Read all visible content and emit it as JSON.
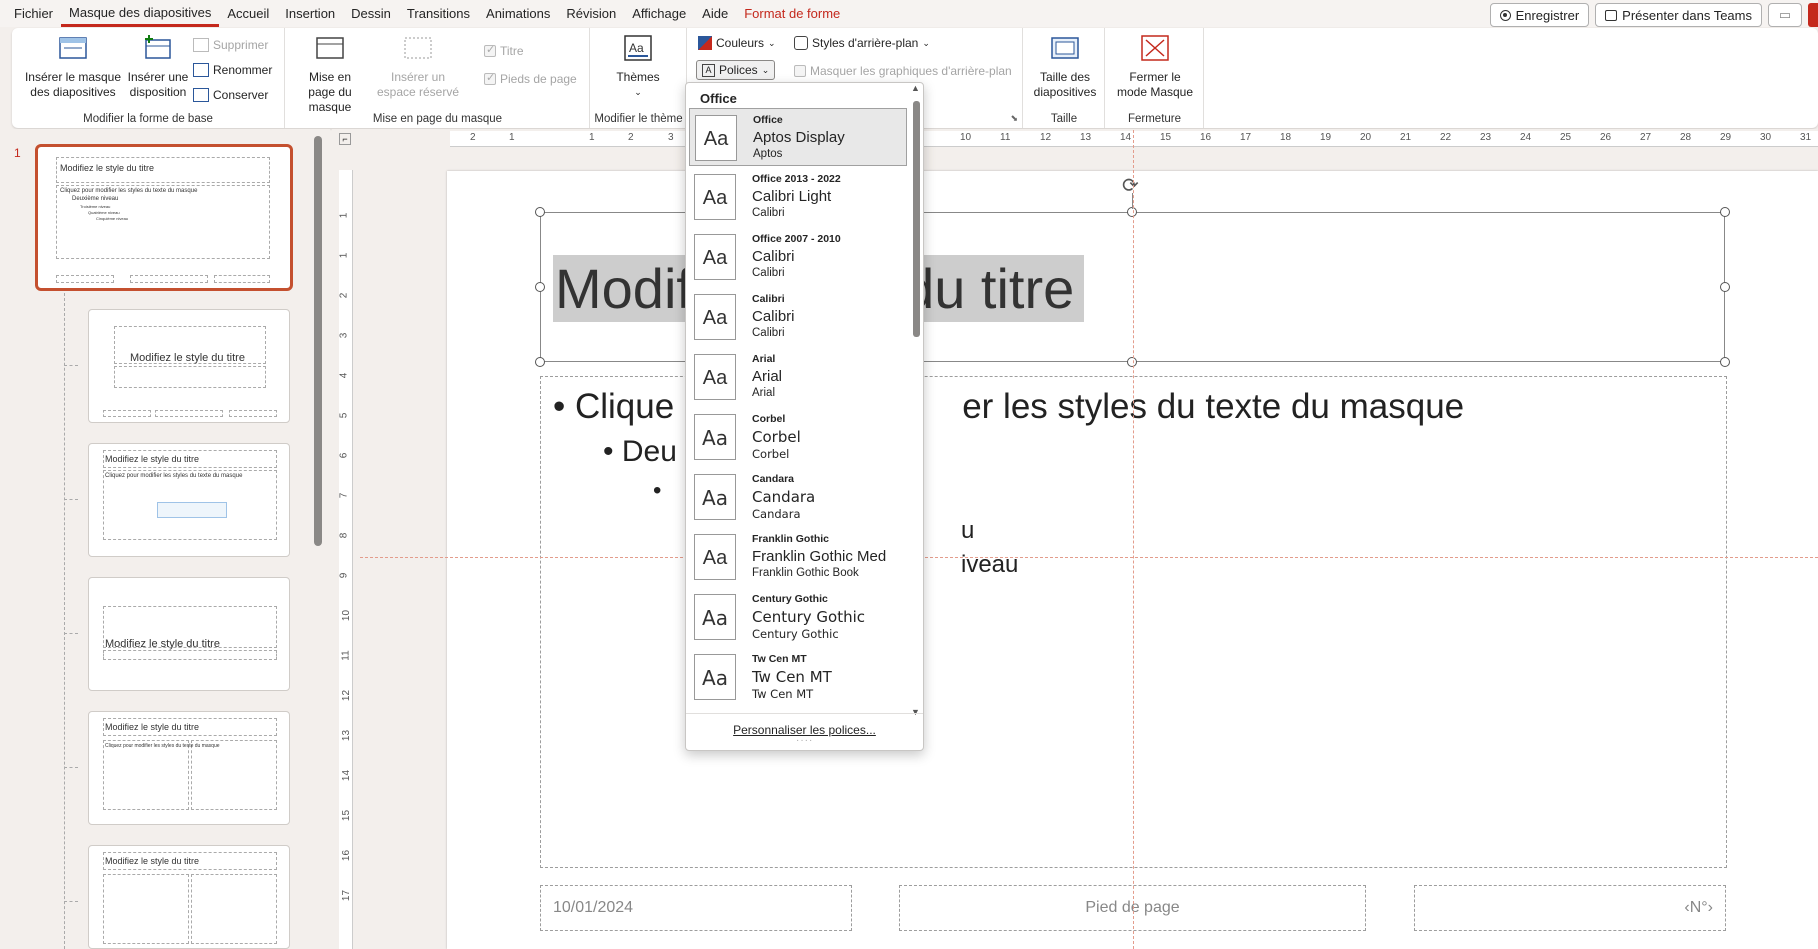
{
  "menu": {
    "items": [
      "Fichier",
      "Masque des diapositives",
      "Accueil",
      "Insertion",
      "Dessin",
      "Transitions",
      "Animations",
      "Révision",
      "Affichage",
      "Aide",
      "Format de forme"
    ],
    "record_label": "Enregistrer",
    "present_teams_label": "Présenter dans Teams"
  },
  "ribbon": {
    "modify_base": {
      "insert_master": "Insérer le masque des diapositives",
      "insert_layout": "Insérer une disposition",
      "delete": "Supprimer",
      "rename": "Renommer",
      "preserve": "Conserver",
      "label": "Modifier la forme de base"
    },
    "master_layout": {
      "master_layout_btn": "Mise en page du masque",
      "insert_placeholder": "Insérer un espace réservé",
      "title_chk": "Titre",
      "footers_chk": "Pieds de page",
      "label": "Mise en page du masque"
    },
    "theme": {
      "themes": "Thèmes",
      "label": "Modifier le thème"
    },
    "background": {
      "colors": "Couleurs",
      "fonts": "Polices",
      "bg_styles": "Styles d'arrière-plan",
      "hide_bg": "Masquer les graphiques d'arrière-plan"
    },
    "size": {
      "slide_size": "Taille des diapositives",
      "label": "Taille"
    },
    "close": {
      "close_master": "Fermer le mode Masque",
      "label": "Fermeture"
    }
  },
  "thumbnails": {
    "slide_number": "1",
    "master_title": "Modifiez le style du titre",
    "master_body": [
      "Cliquez pour modifier les styles du texte du masque",
      "Deuxième niveau",
      "Troisième niveau",
      "Quatrième niveau",
      "Cinquième niveau"
    ],
    "layout_title": "Modifiez le style du titre",
    "two_col_text": "Cliquez pour modifier les styles du texte du masque"
  },
  "slide": {
    "title_visible_a": "Modif",
    "title_visible_b": "le du titre",
    "bullet1_a": "• Clique",
    "bullet1_b": "er les styles du texte du masque",
    "bullet2": "• Deu",
    "bullet3": "•",
    "bullet4_tail": "u",
    "bullet5_tail": "iveau",
    "date": "10/01/2024",
    "footer": "Pied de page",
    "page_num": "‹N°›"
  },
  "ruler": {
    "h_ticks": [
      "2",
      "1",
      "1",
      "2",
      "3",
      "10",
      "11",
      "12",
      "13",
      "14",
      "15",
      "16",
      "17",
      "18",
      "19",
      "20",
      "21",
      "22",
      "23",
      "24",
      "25",
      "26",
      "27",
      "28",
      "29",
      "30",
      "31"
    ],
    "v_ticks": [
      "1",
      "1",
      "2",
      "3",
      "4",
      "5",
      "6",
      "7",
      "8",
      "9",
      "10",
      "11",
      "12",
      "13",
      "14",
      "15",
      "16",
      "17"
    ]
  },
  "fonts_dropdown": {
    "header": "Office",
    "items": [
      {
        "name": "Office",
        "major": "Aptos Display",
        "minor": "Aptos"
      },
      {
        "name": "Office 2013 - 2022",
        "major": "Calibri Light",
        "minor": "Calibri"
      },
      {
        "name": "Office 2007 - 2010",
        "major": "Calibri",
        "minor": "Calibri"
      },
      {
        "name": "Calibri",
        "major": "Calibri",
        "minor": "Calibri"
      },
      {
        "name": "Arial",
        "major": "Arial",
        "minor": "Arial"
      },
      {
        "name": "Corbel",
        "major": "Corbel",
        "minor": "Corbel"
      },
      {
        "name": "Candara",
        "major": "Candara",
        "minor": "Candara"
      },
      {
        "name": "Franklin Gothic",
        "major": "Franklin Gothic Med",
        "minor": "Franklin Gothic Book"
      },
      {
        "name": "Century Gothic",
        "major": "Century Gothic",
        "minor": "Century Gothic"
      },
      {
        "name": "Tw Cen MT",
        "major": "Tw Cen MT",
        "minor": "Tw Cen MT"
      }
    ],
    "preview_glyph": "Aa",
    "customize": "Personnaliser les polices..."
  },
  "colors": {
    "accent": "#c4281c",
    "selection": "#c4502f"
  }
}
